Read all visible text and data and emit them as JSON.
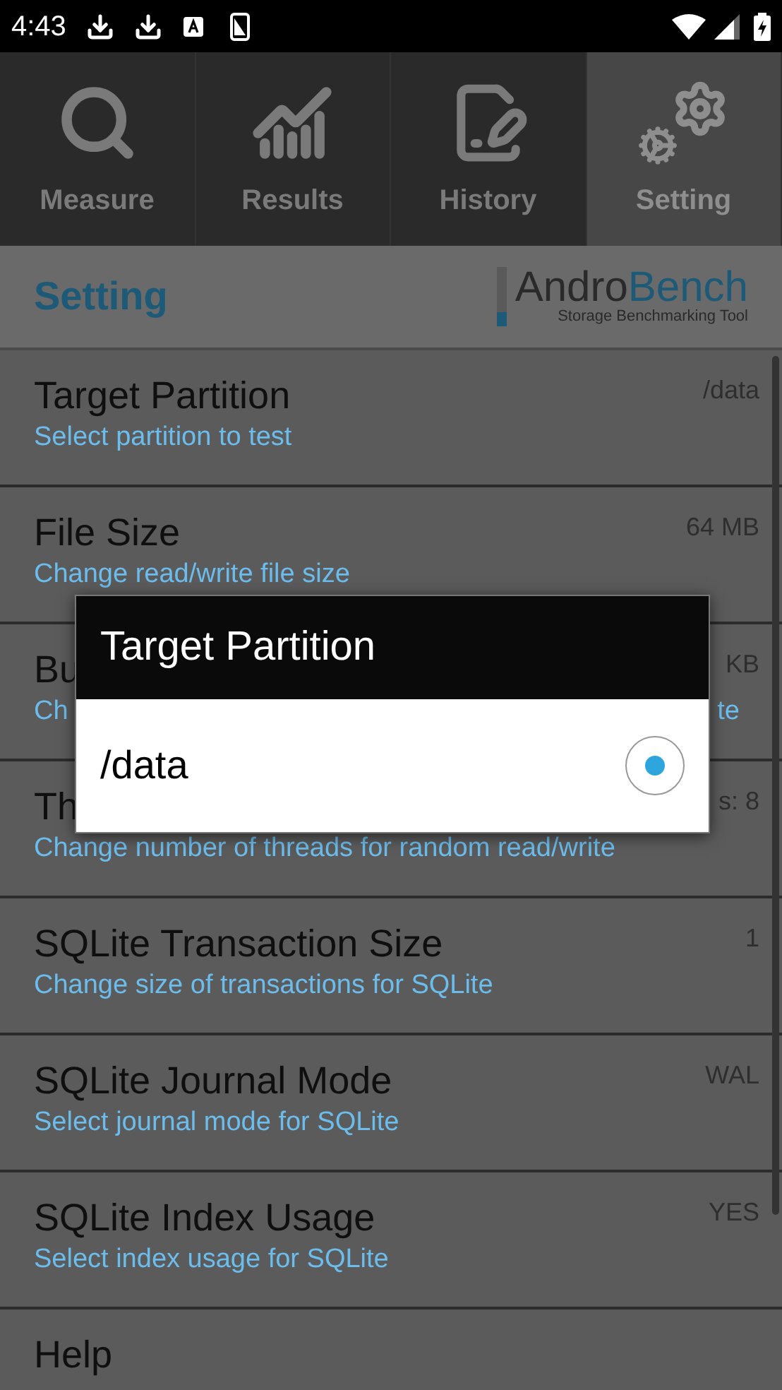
{
  "status_bar": {
    "time": "4:43"
  },
  "tabs": [
    {
      "label": "Measure",
      "selected": false
    },
    {
      "label": "Results",
      "selected": false
    },
    {
      "label": "History",
      "selected": false
    },
    {
      "label": "Setting",
      "selected": true
    }
  ],
  "header": {
    "title": "Setting",
    "logo": {
      "prefix": "Andro",
      "suffix": "Bench",
      "tagline": "Storage Benchmarking Tool"
    }
  },
  "settings": [
    {
      "title": "Target Partition",
      "description": "Select partition to test",
      "value": "/data"
    },
    {
      "title": "File Size",
      "description": "Change read/write file size",
      "value": "64 MB"
    },
    {
      "title": "Bu",
      "description_start": "Ch",
      "description_end": "te",
      "value": "KB"
    },
    {
      "title": "Th",
      "description": "Change number of threads for random read/write",
      "value": "s: 8"
    },
    {
      "title": "SQLite Transaction Size",
      "description": "Change size of transactions for SQLite",
      "value": "1"
    },
    {
      "title": "SQLite Journal Mode",
      "description": "Select journal mode for SQLite",
      "value": "WAL"
    },
    {
      "title": "SQLite Index Usage",
      "description": "Select index usage for SQLite",
      "value": "YES"
    },
    {
      "title": "Help"
    }
  ],
  "dialog": {
    "title": "Target Partition",
    "options": [
      {
        "label": "/data",
        "selected": true
      }
    ]
  }
}
